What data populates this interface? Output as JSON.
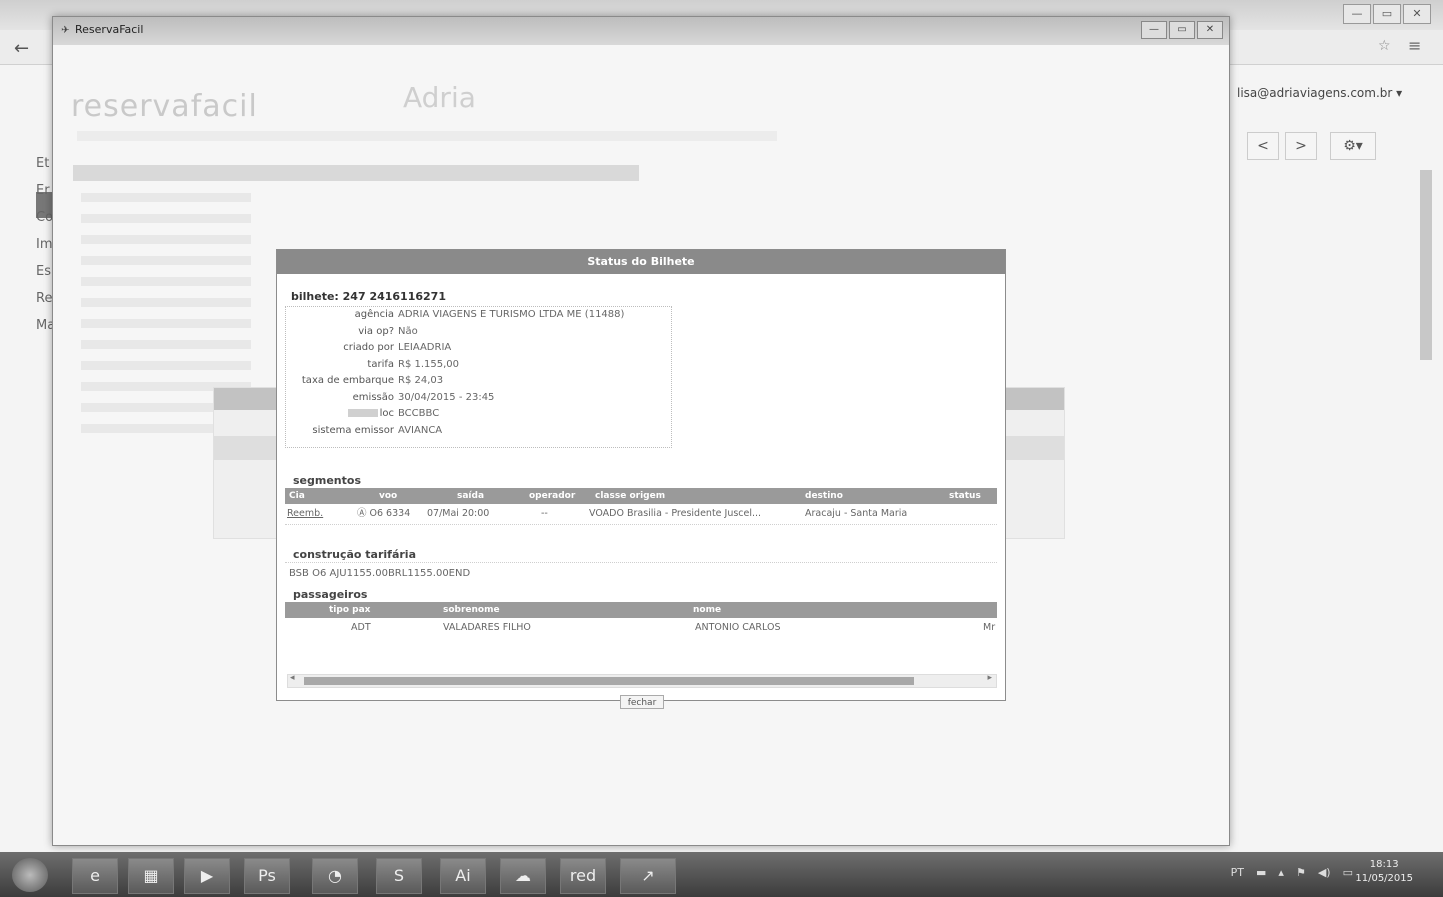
{
  "browser": {
    "email": "lisa@adriaviagens.com.br ▾",
    "nav_prev": "<",
    "nav_next": ">",
    "settings": "⚙▾",
    "back": "←",
    "star": "☆",
    "menu": "≡",
    "window_controls": [
      "—",
      "▭",
      "✕"
    ],
    "left_letters": [
      "Et",
      "",
      "Er",
      "Co",
      "Imp",
      "Es",
      "Re",
      "Ma"
    ]
  },
  "popup": {
    "title": "ReservaFacil",
    "controls": [
      "—",
      "▭",
      "✕"
    ],
    "logo": "reservafacil",
    "logo2": "Adria"
  },
  "modal": {
    "header": "Status do Bilhete",
    "ticket": "bilhete: 247 2416116271",
    "info": [
      {
        "label": "agência",
        "value": "ADRIA VIAGENS E TURISMO LTDA ME (11488)"
      },
      {
        "label": "via op?",
        "value": "Não"
      },
      {
        "label": "criado por",
        "value": "LEIAADRIA"
      },
      {
        "label": "tarifa",
        "value": "R$ 1.155,00"
      },
      {
        "label": "taxa de embarque",
        "value": "R$ 24,03"
      },
      {
        "label": "emissão",
        "value": "30/04/2015 - 23:45"
      },
      {
        "label": "loc",
        "value": "BCCBBC"
      },
      {
        "label": "sistema emissor",
        "value": "AVIANCA"
      }
    ],
    "segments_title": "segmentos",
    "segments_headers": [
      "Cia",
      "voo",
      "saída",
      "operador",
      "classe origem",
      "destino",
      "status"
    ],
    "segment_row": {
      "status_link": "Reemb.",
      "flight": "Ⓐ O6 6334",
      "departure": "07/Mai 20:00",
      "operator": "--",
      "origin": "VOADO Brasilia - Presidente Juscel...",
      "destination": "Aracaju - Santa Maria"
    },
    "fare_title": "construção tarifária",
    "fare_text": "BSB O6 AJU1155.00BRL1155.00END",
    "passengers_title": "passageiros",
    "passengers_headers": [
      "tipo pax",
      "sobrenome",
      "nome"
    ],
    "passenger_row": {
      "type": "ADT",
      "surname": "VALADARES FILHO",
      "name": "ANTONIO CARLOS",
      "extra": "Mr"
    },
    "scroll_left": "◂",
    "scroll_right": "▸",
    "close_label": "fechar"
  },
  "taskbar": {
    "items": [
      "e",
      "▦",
      "▶",
      "Ps",
      "◔",
      "S",
      "Ai",
      "☁",
      "red",
      "↗"
    ],
    "tray": [
      "PT",
      "▬",
      "▴",
      "⚑",
      "◀)",
      "▭"
    ],
    "time": "18:13",
    "date": "11/05/2015"
  }
}
